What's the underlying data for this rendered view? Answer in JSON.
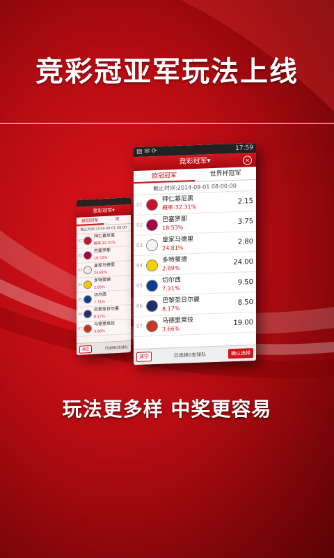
{
  "headline": "竞彩冠亚军玩法上线",
  "slogan": "玩法更多样  中奖更容易",
  "phone": {
    "status_time": "17:59",
    "title": "竞彩冠军▾",
    "close_glyph": "×",
    "tabs": [
      "欧冠冠军",
      "世界杯冠军"
    ],
    "deadline": "截止时间:2014-09-01 08:00:00",
    "rows": [
      {
        "rank": "01",
        "team": "拜仁慕尼黑",
        "pct": "概率:32.31%",
        "odds": "2.15",
        "color": "#c8102e"
      },
      {
        "rank": "02",
        "team": "巴塞罗那",
        "pct": "18.53%",
        "odds": "3.75",
        "color": "#a50044"
      },
      {
        "rank": "03",
        "team": "皇家马德里",
        "pct": "24.81%",
        "odds": "2.80",
        "color": "#f3f3f3"
      },
      {
        "rank": "04",
        "team": "多特蒙德",
        "pct": "2.89%",
        "odds": "24.00",
        "color": "#f5d000"
      },
      {
        "rank": "05",
        "team": "切尔西",
        "pct": "7.31%",
        "odds": "9.50",
        "color": "#0a3d91"
      },
      {
        "rank": "06",
        "team": "巴黎圣日尔曼",
        "pct": "8.17%",
        "odds": "8.50",
        "color": "#1d2f6b"
      },
      {
        "rank": "07",
        "team": "马德里竞技",
        "pct": "3.66%",
        "odds": "19.00",
        "color": "#cb3524"
      }
    ],
    "bottom_left": "清空",
    "bottom_center": "已选择0支球队",
    "bottom_right": "确认选择"
  },
  "back_phone": {
    "title": "竞彩冠军▾",
    "tabs": [
      "欧冠冠军",
      "世"
    ],
    "deadline": "截止时间:2014-09-01 08:00",
    "rows": [
      {
        "rank": "01",
        "team": "拜仁慕尼黑",
        "pct": "概率:32.31%"
      },
      {
        "rank": "02",
        "team": "巴塞罗那",
        "pct": "18.53%"
      },
      {
        "rank": "03",
        "team": "皇家马德里",
        "pct": "24.81%"
      },
      {
        "rank": "04",
        "team": "多特蒙德",
        "pct": "2.89%"
      },
      {
        "rank": "05",
        "team": "切尔西",
        "pct": "7.31%"
      },
      {
        "rank": "06",
        "team": "巴黎圣日尔曼",
        "pct": "8.17%"
      },
      {
        "rank": "07",
        "team": "马德里竞技",
        "pct": "3.66%"
      }
    ],
    "bottom_left": "清空",
    "bottom_center": "已选择0支球队"
  }
}
